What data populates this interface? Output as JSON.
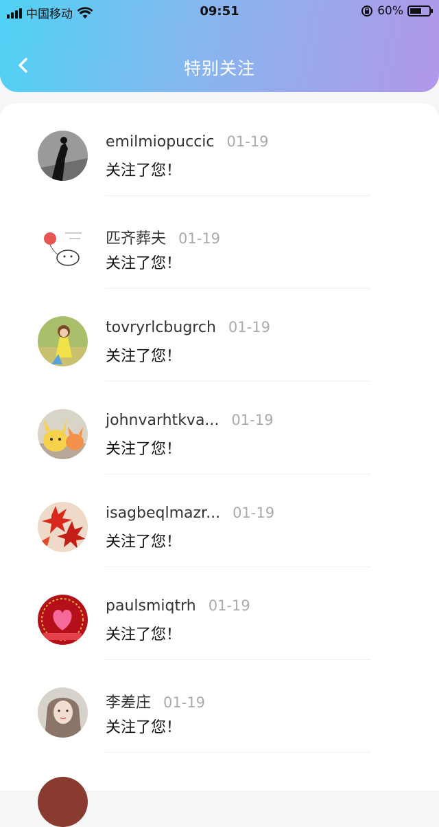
{
  "status_bar": {
    "carrier": "中国移动",
    "time": "09:51",
    "battery_percent": "60%",
    "battery_level": 0.6
  },
  "nav": {
    "title": "特别关注"
  },
  "notifications": [
    {
      "username": "emilmiopuccic",
      "date": "01-19",
      "message": "关注了您！",
      "avatar_icon": "person-silhouette-avatar"
    },
    {
      "username": "匹齐葬夫",
      "date": "01-19",
      "message": "关注了您！",
      "avatar_icon": "balloon-cartoon-avatar"
    },
    {
      "username": "tovryrlcbugrch",
      "date": "01-19",
      "message": "关注了您！",
      "avatar_icon": "girl-in-field-avatar"
    },
    {
      "username": "johnvarhtkva...",
      "date": "01-19",
      "message": "关注了您！",
      "avatar_icon": "pikachu-figures-avatar"
    },
    {
      "username": "isagbeqlmazr...",
      "date": "01-19",
      "message": "关注了您！",
      "avatar_icon": "red-maple-leaves-avatar"
    },
    {
      "username": "paulsmiqtrh",
      "date": "01-19",
      "message": "关注了您！",
      "avatar_icon": "red-heart-avatar"
    },
    {
      "username": "李差庄",
      "date": "01-19",
      "message": "关注了您！",
      "avatar_icon": "woman-portrait-avatar"
    }
  ],
  "colors": {
    "header_gradient_start": "#4fd2f5",
    "header_gradient_end": "#b197ea",
    "date_text": "#aaaaaa"
  }
}
